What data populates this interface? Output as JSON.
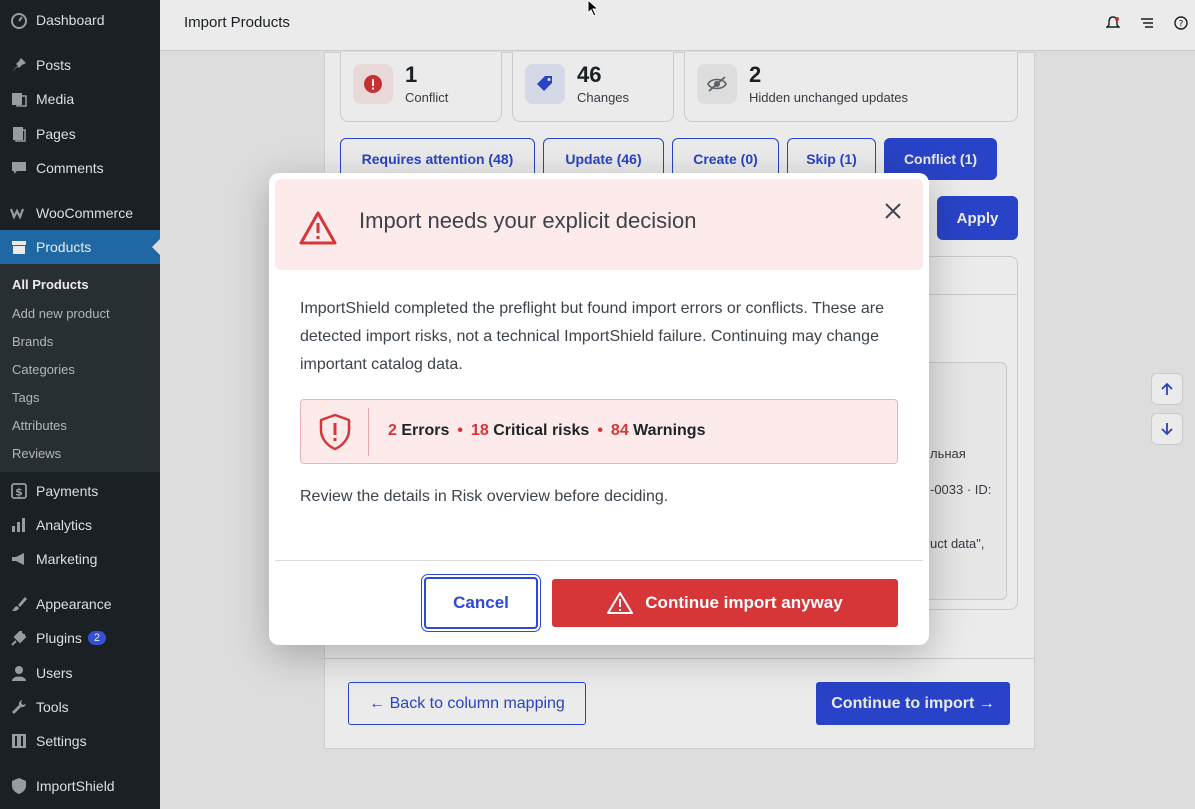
{
  "sidebar": {
    "items": [
      {
        "label": "Dashboard",
        "icon": "dashboard-icon"
      },
      {
        "label": "Posts",
        "icon": "pin-icon"
      },
      {
        "label": "Media",
        "icon": "media-icon"
      },
      {
        "label": "Pages",
        "icon": "pages-icon"
      },
      {
        "label": "Comments",
        "icon": "comment-icon"
      },
      {
        "label": "WooCommerce",
        "icon": "woocommerce-icon"
      },
      {
        "label": "Products",
        "icon": "archive-icon"
      },
      {
        "label": "Payments",
        "icon": "dollar-icon"
      },
      {
        "label": "Analytics",
        "icon": "bar-chart-icon"
      },
      {
        "label": "Marketing",
        "icon": "megaphone-icon"
      },
      {
        "label": "Appearance",
        "icon": "brush-icon"
      },
      {
        "label": "Plugins",
        "icon": "plug-icon",
        "badge": "2"
      },
      {
        "label": "Users",
        "icon": "user-icon"
      },
      {
        "label": "Tools",
        "icon": "wrench-icon"
      },
      {
        "label": "Settings",
        "icon": "settings-icon"
      },
      {
        "label": "ImportShield",
        "icon": "shield-icon"
      }
    ],
    "submenu": [
      "All Products",
      "Add new product",
      "Brands",
      "Categories",
      "Tags",
      "Attributes",
      "Reviews"
    ]
  },
  "header": {
    "title": "Import Products"
  },
  "stats": [
    {
      "value": "1",
      "label": "Conflict"
    },
    {
      "value": "46",
      "label": "Changes"
    },
    {
      "value": "2",
      "label": "Hidden unchanged updates"
    }
  ],
  "tabs": [
    "Requires attention (48)",
    "Update (46)",
    "Create (0)",
    "Skip (1)",
    "Conflict (1)"
  ],
  "apply_label": "Apply",
  "fragments": {
    "f1": "льная",
    "f2": "-0033 · ID:",
    "f3": "uct data\","
  },
  "footer": {
    "back_label": "← Back to column mapping",
    "continue_label": "Continue to import →"
  },
  "modal": {
    "title": "Import needs your explicit decision",
    "body": "ImportShield completed the preflight but found import errors or conflicts. These are detected import risks, not a technical ImportShield failure. Continuing may change important catalog data.",
    "errors_count": "2",
    "errors_label": "Errors",
    "critical_count": "18",
    "critical_label": "Critical risks",
    "warnings_count": "84",
    "warnings_label": "Warnings",
    "review_text": "Review the details in Risk overview before deciding.",
    "cancel_label": "Cancel",
    "continue_label": "Continue import anyway"
  },
  "colors": {
    "accent": "#2c49d8",
    "danger": "#d63638",
    "sidebar": "#1d2327"
  }
}
